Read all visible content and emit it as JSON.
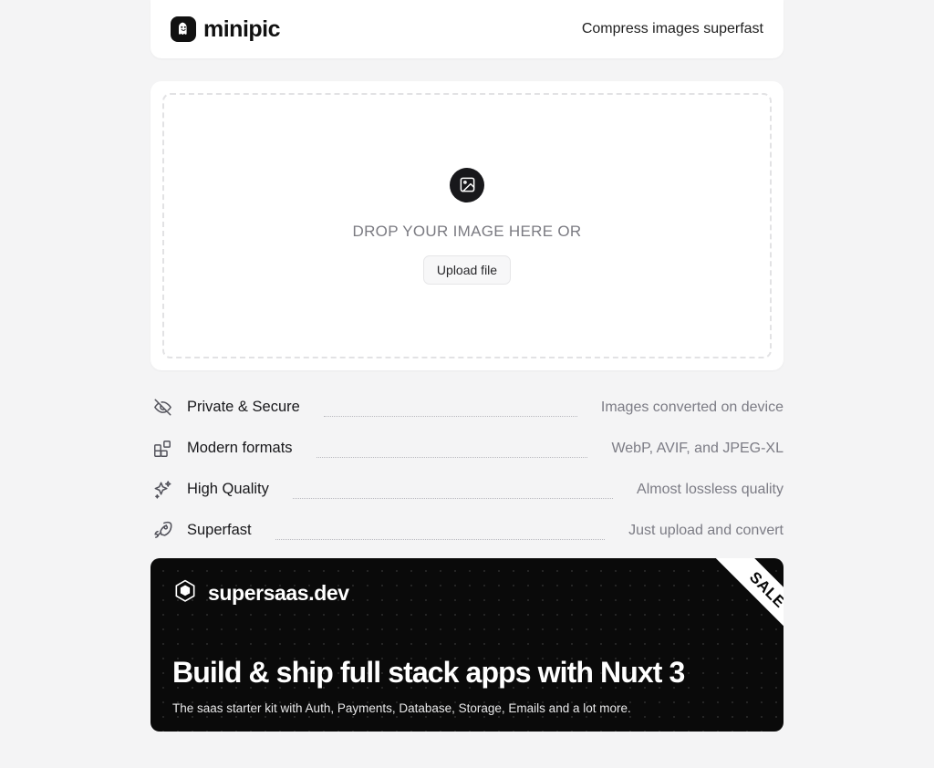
{
  "header": {
    "brand_name": "minipic",
    "logo_icon": "ghost-face-icon",
    "tagline": "Compress images superfast"
  },
  "dropzone": {
    "icon": "image-placeholder-icon",
    "prompt": "DROP YOUR IMAGE HERE OR",
    "upload_button_label": "Upload file"
  },
  "features": [
    {
      "icon": "eye-off-icon",
      "label": "Private & Secure",
      "value": "Images converted on device"
    },
    {
      "icon": "blocks-grid-icon",
      "label": "Modern formats",
      "value": "WebP, AVIF, and JPEG-XL"
    },
    {
      "icon": "sparkles-icon",
      "label": "High Quality",
      "value": "Almost lossless quality"
    },
    {
      "icon": "rocket-icon",
      "label": "Superfast",
      "value": "Just upload and convert"
    }
  ],
  "promo": {
    "icon": "cube-box-icon",
    "brand_name": "supersaas.dev",
    "headline": "Build & ship full stack apps with Nuxt 3",
    "subtitle": "The saas starter kit with Auth, Payments, Database, Storage, Emails and a lot more.",
    "ribbon_label": "SALE"
  },
  "colors": {
    "page_background": "#f4f4f5",
    "card_background": "#ffffff",
    "accent_dark": "#0a0a0a",
    "muted_text": "#7c7c85"
  }
}
